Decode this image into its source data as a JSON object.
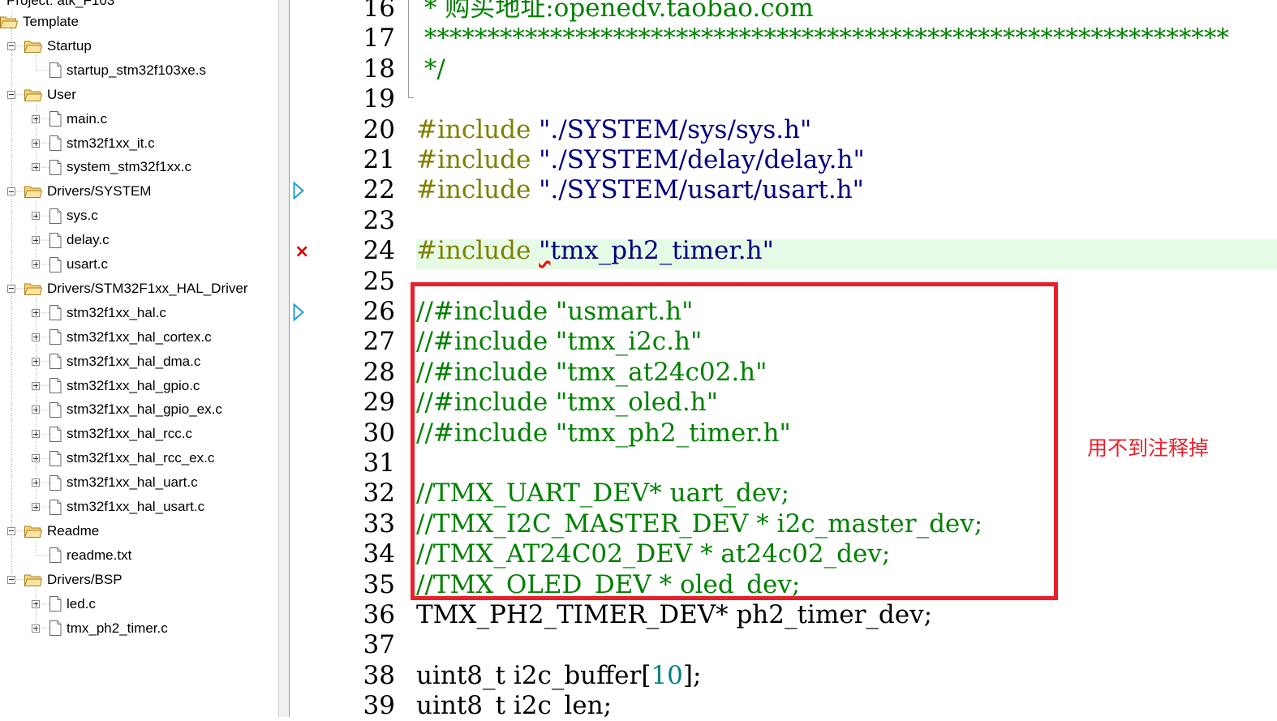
{
  "project_tree": {
    "header_partial": "Project: atk_F103",
    "nodes": [
      {
        "label": "Template",
        "kind": "root",
        "level": 0
      },
      {
        "label": "Startup",
        "kind": "group",
        "level": 1,
        "toggle": "minus"
      },
      {
        "label": "startup_stm32f103xe.s",
        "kind": "file",
        "level": 2,
        "toggle": "none"
      },
      {
        "label": "User",
        "kind": "group",
        "level": 1,
        "toggle": "minus"
      },
      {
        "label": "main.c",
        "kind": "file",
        "level": 2,
        "toggle": "plus"
      },
      {
        "label": "stm32f1xx_it.c",
        "kind": "file",
        "level": 2,
        "toggle": "plus"
      },
      {
        "label": "system_stm32f1xx.c",
        "kind": "file",
        "level": 2,
        "toggle": "plus"
      },
      {
        "label": "Drivers/SYSTEM",
        "kind": "group",
        "level": 1,
        "toggle": "minus"
      },
      {
        "label": "sys.c",
        "kind": "file",
        "level": 2,
        "toggle": "plus"
      },
      {
        "label": "delay.c",
        "kind": "file",
        "level": 2,
        "toggle": "plus"
      },
      {
        "label": "usart.c",
        "kind": "file",
        "level": 2,
        "toggle": "plus"
      },
      {
        "label": "Drivers/STM32F1xx_HAL_Driver",
        "kind": "group",
        "level": 1,
        "toggle": "minus"
      },
      {
        "label": "stm32f1xx_hal.c",
        "kind": "file",
        "level": 2,
        "toggle": "plus"
      },
      {
        "label": "stm32f1xx_hal_cortex.c",
        "kind": "file",
        "level": 2,
        "toggle": "plus"
      },
      {
        "label": "stm32f1xx_hal_dma.c",
        "kind": "file",
        "level": 2,
        "toggle": "plus"
      },
      {
        "label": "stm32f1xx_hal_gpio.c",
        "kind": "file",
        "level": 2,
        "toggle": "plus"
      },
      {
        "label": "stm32f1xx_hal_gpio_ex.c",
        "kind": "file",
        "level": 2,
        "toggle": "plus"
      },
      {
        "label": "stm32f1xx_hal_rcc.c",
        "kind": "file",
        "level": 2,
        "toggle": "plus"
      },
      {
        "label": "stm32f1xx_hal_rcc_ex.c",
        "kind": "file",
        "level": 2,
        "toggle": "plus"
      },
      {
        "label": "stm32f1xx_hal_uart.c",
        "kind": "file",
        "level": 2,
        "toggle": "plus"
      },
      {
        "label": "stm32f1xx_hal_usart.c",
        "kind": "file",
        "level": 2,
        "toggle": "plus"
      },
      {
        "label": "Readme",
        "kind": "group",
        "level": 1,
        "toggle": "minus"
      },
      {
        "label": "readme.txt",
        "kind": "file",
        "level": 2,
        "toggle": "none"
      },
      {
        "label": "Drivers/BSP",
        "kind": "group",
        "level": 1,
        "toggle": "minus"
      },
      {
        "label": "led.c",
        "kind": "file",
        "level": 2,
        "toggle": "plus"
      },
      {
        "label": "tmx_ph2_timer.c",
        "kind": "file",
        "level": 2,
        "toggle": "plus"
      }
    ]
  },
  "editor": {
    "lines": [
      {
        "num": "16",
        "marker": "",
        "highlight": false,
        "tokens": [
          {
            "t": " * 购买地址:openedv.taobao.com",
            "c": "comment"
          }
        ]
      },
      {
        "num": "17",
        "marker": "",
        "highlight": false,
        "tokens": [
          {
            "t": " ****************************************************************",
            "c": "comment"
          }
        ]
      },
      {
        "num": "18",
        "marker": "",
        "highlight": false,
        "tokens": [
          {
            "t": " */",
            "c": "comment"
          }
        ]
      },
      {
        "num": "19",
        "marker": "",
        "highlight": false,
        "tokens": []
      },
      {
        "num": "20",
        "marker": "",
        "highlight": false,
        "tokens": [
          {
            "t": "#include ",
            "c": "pre"
          },
          {
            "t": "\"./SYSTEM/sys/sys.h\"",
            "c": "str"
          }
        ]
      },
      {
        "num": "21",
        "marker": "",
        "highlight": false,
        "tokens": [
          {
            "t": "#include ",
            "c": "pre"
          },
          {
            "t": "\"./SYSTEM/delay/delay.h\"",
            "c": "str"
          }
        ]
      },
      {
        "num": "22",
        "marker": "arrow",
        "highlight": false,
        "tokens": [
          {
            "t": "#include ",
            "c": "pre"
          },
          {
            "t": "\"./SYSTEM/usart/usart.h\"",
            "c": "str"
          }
        ]
      },
      {
        "num": "23",
        "marker": "",
        "highlight": false,
        "tokens": []
      },
      {
        "num": "24",
        "marker": "error",
        "highlight": true,
        "tokens": [
          {
            "t": "#include ",
            "c": "pre"
          },
          {
            "t": "\"",
            "c": "str err"
          },
          {
            "t": "tmx_ph2_timer.h\"",
            "c": "str"
          }
        ]
      },
      {
        "num": "25",
        "marker": "",
        "highlight": false,
        "tokens": []
      },
      {
        "num": "26",
        "marker": "arrow",
        "highlight": false,
        "tokens": [
          {
            "t": "//#include \"usmart.h\"",
            "c": "comment"
          }
        ]
      },
      {
        "num": "27",
        "marker": "",
        "highlight": false,
        "tokens": [
          {
            "t": "//#include \"tmx_i2c.h\"",
            "c": "comment"
          }
        ]
      },
      {
        "num": "28",
        "marker": "",
        "highlight": false,
        "tokens": [
          {
            "t": "//#include \"tmx_at24c02.h\"",
            "c": "comment"
          }
        ]
      },
      {
        "num": "29",
        "marker": "",
        "highlight": false,
        "tokens": [
          {
            "t": "//#include \"tmx_oled.h\"",
            "c": "comment"
          }
        ]
      },
      {
        "num": "30",
        "marker": "",
        "highlight": false,
        "tokens": [
          {
            "t": "//#include \"tmx_ph2_timer.h\"",
            "c": "comment"
          }
        ]
      },
      {
        "num": "31",
        "marker": "",
        "highlight": false,
        "tokens": []
      },
      {
        "num": "32",
        "marker": "",
        "highlight": false,
        "tokens": [
          {
            "t": "//TMX_UART_DEV* uart_dev;",
            "c": "comment"
          }
        ]
      },
      {
        "num": "33",
        "marker": "",
        "highlight": false,
        "tokens": [
          {
            "t": "//TMX_I2C_MASTER_DEV * i2c_master_dev;",
            "c": "comment"
          }
        ]
      },
      {
        "num": "34",
        "marker": "",
        "highlight": false,
        "tokens": [
          {
            "t": "//TMX_AT24C02_DEV * at24c02_dev;",
            "c": "comment"
          }
        ]
      },
      {
        "num": "35",
        "marker": "",
        "highlight": false,
        "tokens": [
          {
            "t": "//TMX_OLED_DEV * oled_dev;",
            "c": "comment"
          }
        ]
      },
      {
        "num": "36",
        "marker": "",
        "highlight": false,
        "tokens": [
          {
            "t": "TMX_PH2_TIMER_DEV* ph2_timer_dev;",
            "c": "plain"
          }
        ]
      },
      {
        "num": "37",
        "marker": "",
        "highlight": false,
        "tokens": []
      },
      {
        "num": "38",
        "marker": "",
        "highlight": false,
        "tokens": [
          {
            "t": "uint8_t i2c_buffer[",
            "c": "plain"
          },
          {
            "t": "10",
            "c": "num"
          },
          {
            "t": "];",
            "c": "plain"
          }
        ]
      },
      {
        "num": "39",
        "marker": "",
        "highlight": false,
        "tokens": [
          {
            "t": "uint8_t i2c_len;",
            "c": "plain"
          }
        ]
      }
    ]
  },
  "annotation": {
    "note": "用不到注释掉",
    "color": "#e8202a"
  },
  "colors": {
    "comment": "#008000",
    "preprocessor": "#7f7f00",
    "string": "#000080",
    "number": "#008080",
    "highlight_line": "#e6fbe6",
    "folder": "#f6d37a"
  }
}
